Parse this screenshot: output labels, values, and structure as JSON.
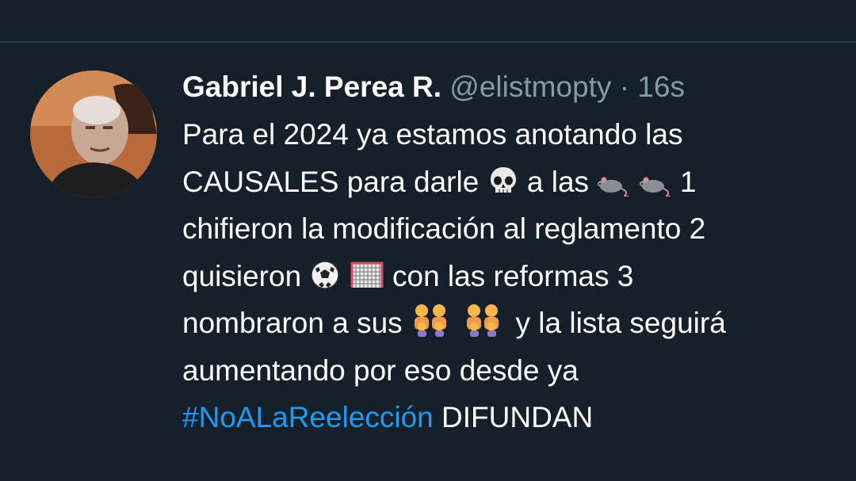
{
  "tweet": {
    "author_name": "Gabriel J. Perea R.",
    "handle": "@elistmopty",
    "separator": "·",
    "time": "16s",
    "line1": "Para el 2024 ya estamos anotando las",
    "line2_a": "CAUSALES para darle",
    "line2_b": "a las",
    "line2_c": "1",
    "line3": "chifieron la modificación al reglamento 2",
    "line4_a": "quisieron",
    "line4_b": "con las reformas 3",
    "line5_a": "nombraron a sus",
    "line5_b": "y la lista seguirá",
    "line6": "aumentando por eso desde ya",
    "hashtag": "#NoALaReelección",
    "line7_tail": "DIFUNDAN"
  },
  "icons": {
    "avatar": "profile-photo",
    "e1": "skull-emoji",
    "e2": "rat-emoji",
    "e3": "rat-emoji",
    "e4": "soccer-ball-emoji",
    "e5": "goal-net-emoji",
    "e6": "family-emoji",
    "e7": "family-emoji"
  },
  "colors": {
    "background": "#15202b",
    "text": "#ffffff",
    "muted": "#8899a6",
    "link": "#1d9bf0"
  }
}
